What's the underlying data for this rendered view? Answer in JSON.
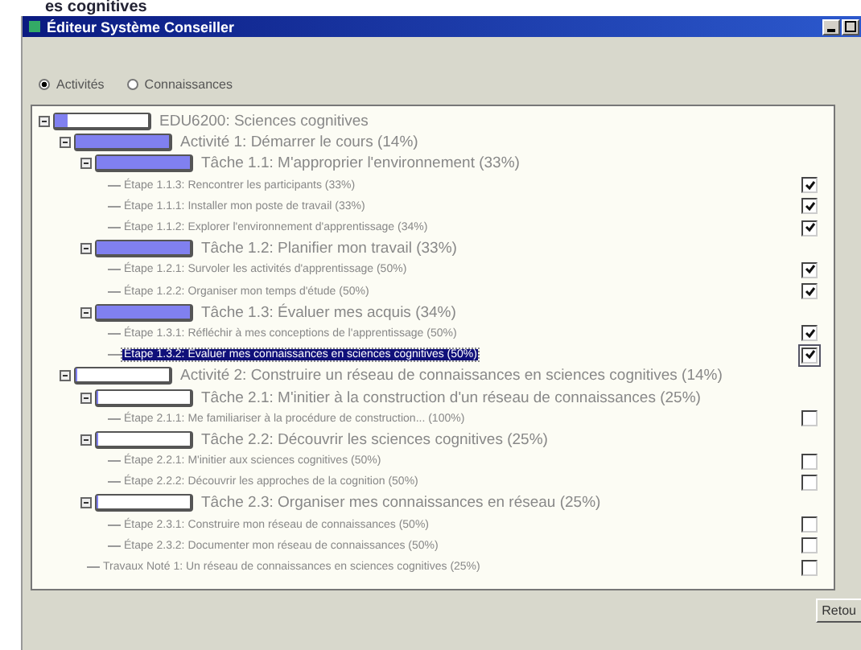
{
  "page_heading": "es cognitives",
  "window": {
    "title": "Éditeur Système Conseiller"
  },
  "view_options": [
    {
      "label": "Activités",
      "selected": true
    },
    {
      "label": "Connaissances",
      "selected": false
    }
  ],
  "tree": [
    {
      "kind": "group",
      "label": "EDU6200: Sciences cognitives",
      "level": 0.14,
      "expanded": true,
      "selected": false,
      "children": [
        {
          "kind": "group",
          "label": "Activité 1: Démarrer le cours (14%)",
          "level": 1,
          "expanded": true,
          "selected": false,
          "children": [
            {
              "kind": "group",
              "label": "Tâche 1.1: M'approprier l'environnement (33%)",
              "level": 1,
              "expanded": true,
              "selected": false,
              "children": [
                {
                  "kind": "step",
                  "label": "Étape 1.1.3: Rencontrer les participants (33%)",
                  "checked": true,
                  "selected": false
                },
                {
                  "kind": "step",
                  "label": "Étape 1.1.1: Installer mon poste de travail (33%)",
                  "checked": true,
                  "selected": false
                },
                {
                  "kind": "step",
                  "label": "Étape 1.1.2: Explorer l'environnement d'apprentissage (34%)",
                  "checked": true,
                  "selected": false
                }
              ]
            },
            {
              "kind": "group",
              "label": "Tâche 1.2: Planifier mon travail (33%)",
              "level": 1,
              "expanded": true,
              "selected": false,
              "children": [
                {
                  "kind": "step",
                  "label": "Étape 1.2.1: Survoler les activités d'apprentissage (50%)",
                  "checked": true,
                  "selected": false
                },
                {
                  "kind": "step",
                  "label": "Étape 1.2.2: Organiser mon temps d'étude (50%)",
                  "checked": true,
                  "selected": false
                }
              ]
            },
            {
              "kind": "group",
              "label": "Tâche 1.3: Évaluer mes acquis (34%)",
              "level": 1,
              "expanded": true,
              "selected": false,
              "children": [
                {
                  "kind": "step",
                  "label": "Étape 1.3.1: Réfléchir à mes conceptions de l'apprentissage (50%)",
                  "checked": true,
                  "selected": false
                },
                {
                  "kind": "step",
                  "label": "Étape 1.3.2: Évaluer mes connaissances en sciences cognitives (50%)",
                  "checked": true,
                  "selected": true
                }
              ]
            }
          ]
        },
        {
          "kind": "group",
          "label": "Activité 2: Construire un réseau de connaissances en sciences cognitives (14%)",
          "level": 0,
          "expanded": true,
          "selected": false,
          "children": [
            {
              "kind": "group",
              "label": "Tâche 2.1: M'initier à la construction d'un réseau de connaissances (25%)",
              "level": 0,
              "expanded": true,
              "selected": false,
              "children": [
                {
                  "kind": "step",
                  "label": "Étape 2.1.1: Me familiariser à la procédure de construction... (100%)",
                  "checked": false,
                  "selected": false
                }
              ]
            },
            {
              "kind": "group",
              "label": "Tâche 2.2: Découvrir les sciences cognitives (25%)",
              "level": 0,
              "expanded": true,
              "selected": false,
              "children": [
                {
                  "kind": "step",
                  "label": "Étape 2.2.1: M'initier aux sciences cognitives (50%)",
                  "checked": false,
                  "selected": false
                },
                {
                  "kind": "step",
                  "label": "Étape 2.2.2: Découvrir les approches de la cognition (50%)",
                  "checked": false,
                  "selected": false
                }
              ]
            },
            {
              "kind": "group",
              "label": "Tâche 2.3: Organiser mes connaissances en réseau (25%)",
              "level": 0,
              "expanded": true,
              "selected": false,
              "children": [
                {
                  "kind": "step",
                  "label": "Étape 2.3.1: Construire mon réseau de connaissances (50%)",
                  "checked": false,
                  "selected": false
                },
                {
                  "kind": "step",
                  "label": "Étape 2.3.2: Documenter mon réseau de connaissances (50%)",
                  "checked": false,
                  "selected": false
                }
              ]
            },
            {
              "kind": "step",
              "label": "Travaux Noté 1: Un réseau de connaissances en sciences cognitives (25%)",
              "checked": false,
              "selected": false
            }
          ]
        }
      ]
    }
  ],
  "buttons": [
    {
      "label": "Retou"
    }
  ]
}
